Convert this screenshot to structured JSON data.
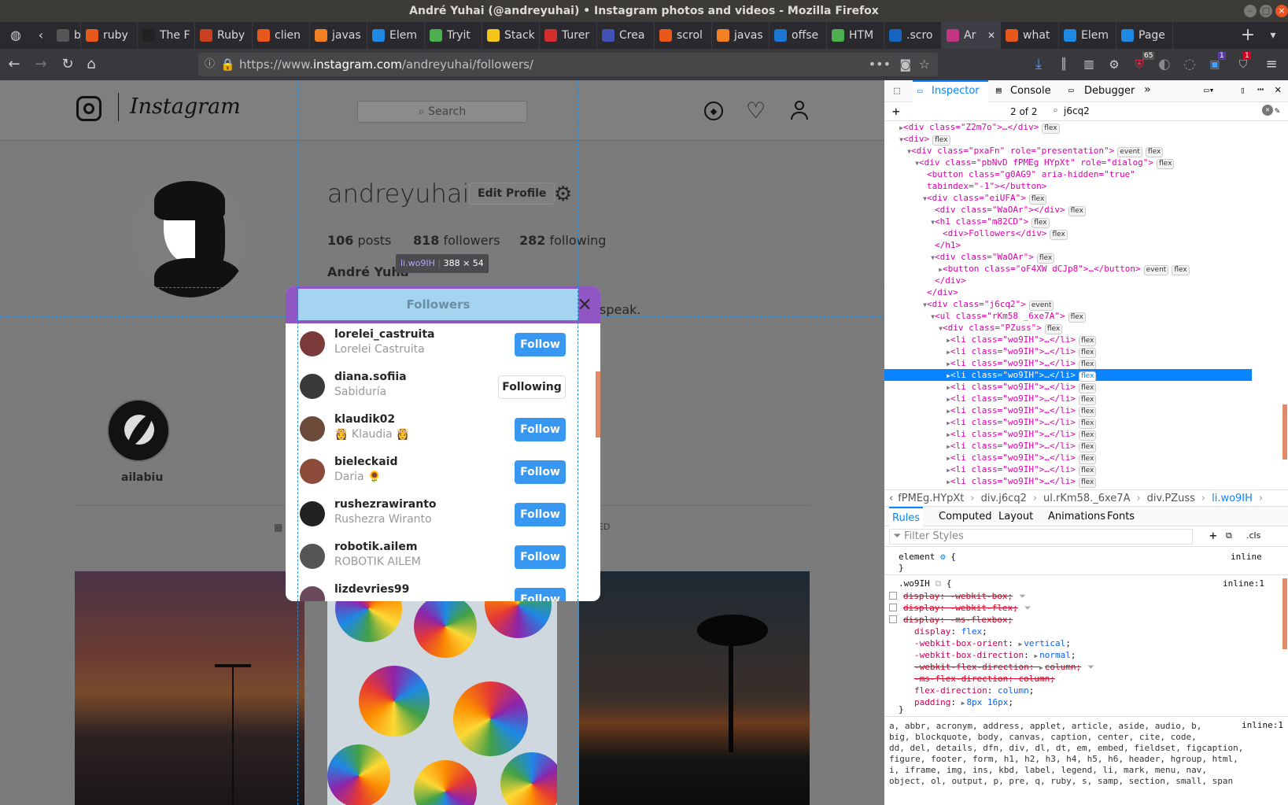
{
  "window": {
    "title": "André Yuhai (@andreyuhai) • Instagram photos and videos - Mozilla Firefox"
  },
  "tabs": [
    {
      "label": "by",
      "color": "#555"
    },
    {
      "label": "ruby",
      "color": "#e8571c"
    },
    {
      "label": "The F",
      "color": "#222"
    },
    {
      "label": "Ruby",
      "color": "#c84020"
    },
    {
      "label": "clien",
      "color": "#e8571c"
    },
    {
      "label": "javas",
      "color": "#f48024"
    },
    {
      "label": "Elem",
      "color": "#1e88e5"
    },
    {
      "label": "Tryit",
      "color": "#4caf50"
    },
    {
      "label": "Stack",
      "color": "#f5c518"
    },
    {
      "label": "Turer",
      "color": "#d32f2f"
    },
    {
      "label": "Crea",
      "color": "#3f51b5"
    },
    {
      "label": "scrol",
      "color": "#e8571c"
    },
    {
      "label": "javas",
      "color": "#f48024"
    },
    {
      "label": "offse",
      "color": "#1976d2"
    },
    {
      "label": "HTM",
      "color": "#4caf50"
    },
    {
      "label": ".scro",
      "color": "#1565c0"
    },
    {
      "label": "Ar",
      "color": "#c13584"
    },
    {
      "label": "what",
      "color": "#e8571c"
    },
    {
      "label": "Elem",
      "color": "#1e88e5"
    },
    {
      "label": "Page",
      "color": "#1e88e5"
    }
  ],
  "url": {
    "prefix": "https://www.",
    "domain": "instagram.com",
    "path": "/andreyuhai/followers/"
  },
  "extension_badges": {
    "first": "65",
    "second": "1",
    "third": "1"
  },
  "instagram": {
    "wordmark": "Instagram",
    "search_placeholder": "Search",
    "username": "andreyuhai",
    "edit_profile": "Edit Profile",
    "posts_count": "106",
    "posts_label": "posts",
    "followers_count": "818",
    "followers_label": "followers",
    "following_count": "282",
    "following_label": "following",
    "full_name": "André Yuha",
    "bio_fragment": "speak.",
    "highlight_name": "ailabiu",
    "tagged_fragment": "ED",
    "tooltip_name": "li.wo9IH",
    "tooltip_size": "388 × 54"
  },
  "dialog": {
    "title": "Followers",
    "close": "×",
    "followers": [
      {
        "username": "lorelei_castruita",
        "name": "Lorelei Castruita",
        "button": "Follow",
        "following": false
      },
      {
        "username": "diana.sofiia",
        "name": "Sabiduría",
        "button": "Following",
        "following": true
      },
      {
        "username": "klaudik02",
        "name": "👸 Klaudia 👸",
        "button": "Follow",
        "following": false
      },
      {
        "username": "bieleckaid",
        "name": "Daria 🌻",
        "button": "Follow",
        "following": false
      },
      {
        "username": "rushezrawiranto",
        "name": "Rushezra Wiranto",
        "button": "Follow",
        "following": false
      },
      {
        "username": "robotik.ailem",
        "name": "ROBOTIK AILEM",
        "button": "Follow",
        "following": false
      },
      {
        "username": "lizdevries99",
        "name": "",
        "button": "Follow",
        "following": false
      }
    ]
  },
  "devtools": {
    "tabs": {
      "inspector": "Inspector",
      "console": "Console",
      "debugger": "Debugger"
    },
    "search_count": "2 of 2",
    "search_value": "j6cq2",
    "markup": [
      {
        "indent": 2,
        "arrow": "▶",
        "html": "<div class=\"Z2m7o\">…</div>",
        "badge": "flex"
      },
      {
        "indent": 2,
        "arrow": "▼",
        "html": "<div>",
        "badge": "flex"
      },
      {
        "indent": 3,
        "arrow": "▼",
        "html": "<div class=\"pxaFn\" role=\"presentation\">",
        "badge": "event",
        "badge2": "flex"
      },
      {
        "indent": 4,
        "arrow": "▼",
        "html": "<div class=\"pbNvD fPMEg HYpXt\" role=\"dialog\">",
        "badge": "flex"
      },
      {
        "indent": 5,
        "arrow": "",
        "html": "<button class=\"g0AG9\" aria-hidden=\"true\""
      },
      {
        "indent": 5,
        "arrow": "",
        "html": "tabindex=\"-1\"></button>"
      },
      {
        "indent": 5,
        "arrow": "▼",
        "html": "<div class=\"eiUFA\">",
        "badge": "flex"
      },
      {
        "indent": 6,
        "arrow": "",
        "html": "<div class=\"WaOAr\"></div>",
        "badge": "flex"
      },
      {
        "indent": 6,
        "arrow": "▼",
        "html": "<h1 class=\"m82CD\">",
        "badge": "flex"
      },
      {
        "indent": 7,
        "arrow": "",
        "html": "<div>Followers</div>",
        "badge": "flex"
      },
      {
        "indent": 6,
        "arrow": "",
        "html": "</h1>"
      },
      {
        "indent": 6,
        "arrow": "▼",
        "html": "<div class=\"WaOAr\">",
        "badge": "flex"
      },
      {
        "indent": 7,
        "arrow": "▶",
        "html": "<button class=\"oF4XW dCJp8\">…</button>",
        "badge": "event",
        "badge2": "flex"
      },
      {
        "indent": 6,
        "arrow": "",
        "html": "</div>"
      },
      {
        "indent": 5,
        "arrow": "",
        "html": "</div>"
      },
      {
        "indent": 5,
        "arrow": "▼",
        "html": "<div class=\"j6cq2\">",
        "badge": "event"
      },
      {
        "indent": 6,
        "arrow": "▼",
        "html": "<ul class=\"rKm58 _6xe7A\">",
        "badge": "flex"
      },
      {
        "indent": 7,
        "arrow": "▼",
        "html": "<div class=\"PZuss\">",
        "badge": "flex"
      },
      {
        "indent": 8,
        "arrow": "▶",
        "html": "<li class=\"wo9IH\">…</li>",
        "badge": "flex"
      },
      {
        "indent": 8,
        "arrow": "▶",
        "html": "<li class=\"wo9IH\">…</li>",
        "badge": "flex"
      },
      {
        "indent": 8,
        "arrow": "▶",
        "html": "<li class=\"wo9IH\">…</li>",
        "badge": "flex"
      },
      {
        "indent": 8,
        "arrow": "▶",
        "html": "<li class=\"wo9IH\">…</li>",
        "badge": "flex",
        "selected": true
      },
      {
        "indent": 8,
        "arrow": "▶",
        "html": "<li class=\"wo9IH\">…</li>",
        "badge": "flex"
      },
      {
        "indent": 8,
        "arrow": "▶",
        "html": "<li class=\"wo9IH\">…</li>",
        "badge": "flex"
      },
      {
        "indent": 8,
        "arrow": "▶",
        "html": "<li class=\"wo9IH\">…</li>",
        "badge": "flex"
      },
      {
        "indent": 8,
        "arrow": "▶",
        "html": "<li class=\"wo9IH\">…</li>",
        "badge": "flex"
      },
      {
        "indent": 8,
        "arrow": "▶",
        "html": "<li class=\"wo9IH\">…</li>",
        "badge": "flex"
      },
      {
        "indent": 8,
        "arrow": "▶",
        "html": "<li class=\"wo9IH\">…</li>",
        "badge": "flex"
      },
      {
        "indent": 8,
        "arrow": "▶",
        "html": "<li class=\"wo9IH\">…</li>",
        "badge": "flex"
      },
      {
        "indent": 8,
        "arrow": "▶",
        "html": "<li class=\"wo9IH\">…</li>",
        "badge": "flex"
      },
      {
        "indent": 8,
        "arrow": "▶",
        "html": "<li class=\"wo9IH\">…</li>",
        "badge": "flex"
      }
    ],
    "breadcrumbs": [
      "fPMEg.HYpXt",
      "div.j6cq2",
      "ul.rKm58._6xe7A",
      "div.PZuss",
      "li.wo9IH"
    ],
    "rule_tabs": [
      "Rules",
      "Computed",
      "Layout",
      "Animations",
      "Fonts"
    ],
    "filter_placeholder": "Filter Styles",
    "cls_label": ".cls",
    "element_rule": {
      "selector": "element",
      "source": "inline"
    },
    "wo9IH_rule": {
      "selector": ".wo9IH",
      "source": "inline:1",
      "decls": [
        {
          "prop": "display",
          "value": "-webkit-box",
          "struck": true,
          "checkbox": true
        },
        {
          "prop": "display",
          "value": "-webkit-flex",
          "struck": true,
          "checkbox": true
        },
        {
          "prop": "display",
          "value": "-ms-flexbox",
          "struck": true,
          "checkbox": true
        },
        {
          "prop": "display",
          "value": "flex",
          "struck": false
        },
        {
          "prop": "-webkit-box-orient",
          "value": "vertical",
          "struck": false,
          "arrow": true
        },
        {
          "prop": "-webkit-box-direction",
          "value": "normal",
          "struck": false,
          "arrow": true
        },
        {
          "prop": "-webkit-flex-direction",
          "value": "column",
          "struck": true,
          "arrow": true
        },
        {
          "prop": "-ms-flex-direction",
          "value": "column",
          "struck": true
        },
        {
          "prop": "flex-direction",
          "value": "column",
          "struck": false
        },
        {
          "prop": "padding",
          "value": "8px 16px",
          "struck": false,
          "arrow": true
        }
      ]
    },
    "ua_selector_lines": [
      "a, abbr, acronym, address, applet, article, aside, audio, b,",
      "big, blockquote, body, canvas, caption, center, cite, code,",
      "dd, del, details, dfn, div, dl, dt, em, embed, fieldset, figcaption,",
      "figure, footer, form, h1, h2, h3, h4, h5, h6, header, hgroup, html,",
      "i, iframe, img, ins, kbd, label, legend, li, mark, menu, nav,",
      "object, ol, output, p, pre, q, ruby, s, samp, section, small, span"
    ],
    "ua_source": "inline:1"
  }
}
